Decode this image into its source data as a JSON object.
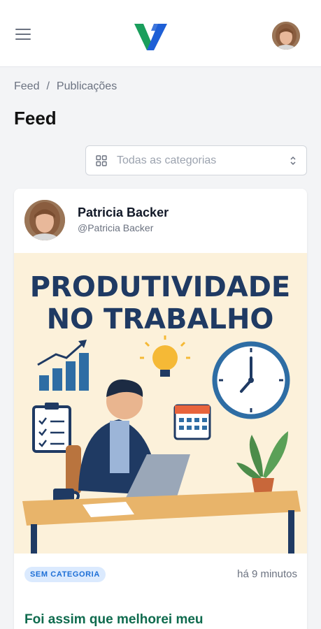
{
  "header": {
    "menu_icon": "hamburger-menu-icon",
    "logo_icon": "brand-v-logo-icon",
    "avatar_icon": "user-avatar"
  },
  "breadcrumb": {
    "items": [
      "Feed",
      "Publicações"
    ],
    "separator": "/"
  },
  "page": {
    "title": "Feed"
  },
  "category_filter": {
    "placeholder": "Todas as categorias",
    "icon": "grid-icon",
    "chevron_icon": "chevron-up-down-icon"
  },
  "post": {
    "author_name": "Patricia Backer",
    "author_handle": "@Patricia Backer",
    "image": {
      "line1": "PRODUTIVIDADE",
      "line2": "NO TRABALHO"
    },
    "category_badge": "SEM CATEGORIA",
    "time_ago": "há 9 minutos",
    "title": "Foi assim que melhorei meu"
  },
  "colors": {
    "brand_green": "#1a9e5c",
    "brand_blue": "#1e5fd6",
    "post_title_green": "#0f6b4e",
    "badge_bg": "#dbeafe",
    "badge_text": "#1d6fd6",
    "image_bg": "#fcf1da",
    "image_headline": "#1f3a63"
  }
}
